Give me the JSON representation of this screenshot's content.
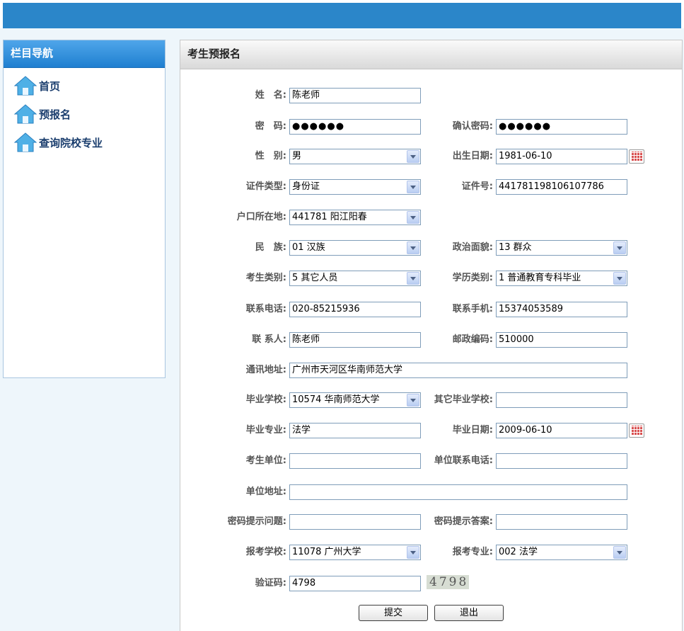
{
  "sidebar": {
    "title": "栏目导航",
    "items": [
      {
        "label": "首页"
      },
      {
        "label": "预报名"
      },
      {
        "label": "查询院校专业"
      }
    ]
  },
  "main": {
    "title": "考生预报名"
  },
  "form": {
    "name_label": "姓　名:",
    "name_value": "陈老师",
    "password_label": "密　码:",
    "password_value": "●●●●●●",
    "confirm_password_label": "确认密码:",
    "confirm_password_value": "●●●●●●",
    "gender_label": "性　别:",
    "gender_value": "男",
    "birth_label": "出生日期:",
    "birth_value": "1981-06-10",
    "id_type_label": "证件类型:",
    "id_type_value": "身份证",
    "id_number_label": "证件号:",
    "id_number_value": "441781198106107786",
    "hukou_label": "户口所在地:",
    "hukou_value": "441781 阳江阳春",
    "ethnic_label": "民　族:",
    "ethnic_value": "01 汉族",
    "political_label": "政治面貌:",
    "political_value": "13 群众",
    "candidate_type_label": "考生类别:",
    "candidate_type_value": "5 其它人员",
    "education_label": "学历类别:",
    "education_value": "1 普通教育专科毕业",
    "phone_label": "联系电话:",
    "phone_value": "020-85215936",
    "mobile_label": "联系手机:",
    "mobile_value": "15374053589",
    "contact_label": "联 系人:",
    "contact_value": "陈老师",
    "postcode_label": "邮政编码:",
    "postcode_value": "510000",
    "address_label": "通讯地址:",
    "address_value": "广州市天河区华南师范大学",
    "grad_school_label": "毕业学校:",
    "grad_school_value": "10574 华南师范大学",
    "other_school_label": "其它毕业学校:",
    "other_school_value": "",
    "grad_major_label": "毕业专业:",
    "grad_major_value": "法学",
    "grad_date_label": "毕业日期:",
    "grad_date_value": "2009-06-10",
    "employer_label": "考生单位:",
    "employer_value": "",
    "employer_phone_label": "单位联系电话:",
    "employer_phone_value": "",
    "employer_address_label": "单位地址:",
    "employer_address_value": "",
    "pw_question_label": "密码提示问题:",
    "pw_question_value": "",
    "pw_answer_label": "密码提示答案:",
    "pw_answer_value": "",
    "apply_school_label": "报考学校:",
    "apply_school_value": "11078 广州大学",
    "apply_major_label": "报考专业:",
    "apply_major_value": "002 法学",
    "captcha_label": "验证码:",
    "captcha_value": "4798",
    "captcha_image_text": "4798",
    "submit_label": "提交",
    "exit_label": "退出"
  }
}
